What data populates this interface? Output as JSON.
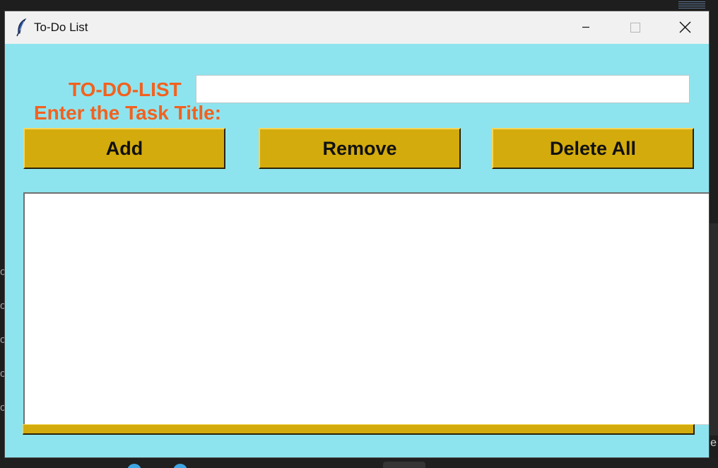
{
  "window": {
    "title": "To-Do List"
  },
  "form": {
    "heading": "TO-DO-LIST",
    "prompt": "Enter the Task Title:",
    "task_input": {
      "value": "",
      "placeholder": ""
    }
  },
  "buttons": {
    "add": "Add",
    "remove": "Remove",
    "delete_all": "Delete All"
  },
  "task_list": {
    "items": []
  },
  "colors": {
    "background": "#8ee4ee",
    "label_text": "#f2611f",
    "button_fill": "#d4ab0d",
    "titlebar": "#f1f1f1"
  },
  "icons": {
    "app": "feather-icon",
    "minimize": "minimize-icon",
    "maximize": "maximize-icon",
    "close": "close-icon"
  }
}
